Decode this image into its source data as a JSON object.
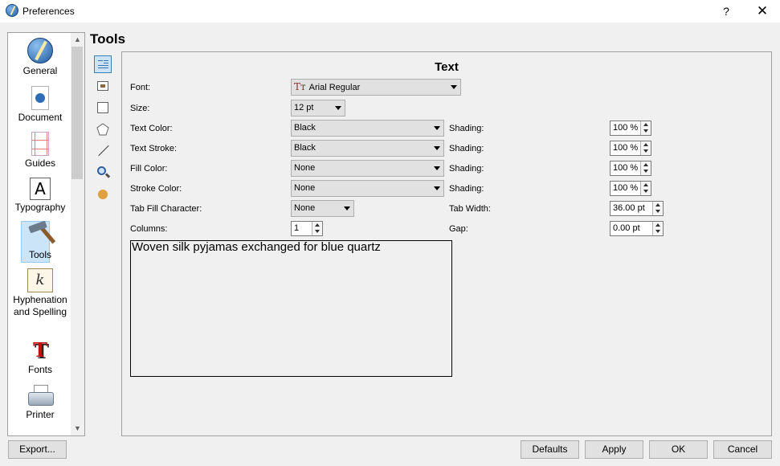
{
  "window": {
    "title": "Preferences",
    "help_label": "?",
    "close_label": "✕"
  },
  "categories": [
    {
      "label": "General",
      "icon": "general-icon"
    },
    {
      "label": "Document",
      "icon": "document-icon"
    },
    {
      "label": "Guides",
      "icon": "guides-icon"
    },
    {
      "label": "Typography",
      "icon": "typography-icon",
      "glyph": "A"
    },
    {
      "label": "Tools",
      "icon": "hammer-icon",
      "selected": true
    },
    {
      "label": "Hyphenation and Spelling",
      "icon": "hyphenation-icon",
      "glyph": "k"
    },
    {
      "label": "Fonts",
      "icon": "fonts-icon",
      "glyph": "T"
    },
    {
      "label": "Printer",
      "icon": "printer-icon"
    }
  ],
  "scroll": {
    "up": "▲",
    "down": "▼"
  },
  "section_title": "Tools",
  "tool_buttons": [
    "text-frame-icon",
    "image-frame-icon",
    "shape-icon",
    "polygon-icon",
    "line-icon",
    "zoom-icon",
    "miscellaneous-icon"
  ],
  "panel": {
    "heading": "Text",
    "font": {
      "label": "Font:",
      "value": "Arial Regular",
      "glyph": "Tт"
    },
    "size": {
      "label": "Size:",
      "value": "12 pt"
    },
    "text_color": {
      "label": "Text Color:",
      "value": "Black",
      "shading_label": "Shading:",
      "shading": "100 %"
    },
    "text_stroke": {
      "label": "Text Stroke:",
      "value": "Black",
      "shading_label": "Shading:",
      "shading": "100 %"
    },
    "fill_color": {
      "label": "Fill Color:",
      "value": "None",
      "shading_label": "Shading:",
      "shading": "100 %"
    },
    "stroke_color": {
      "label": "Stroke Color:",
      "value": "None",
      "shading_label": "Shading:",
      "shading": "100 %"
    },
    "tab_fill": {
      "label": "Tab Fill Character:",
      "value": "None",
      "tab_width_label": "Tab Width:",
      "tab_width": "36.00 pt"
    },
    "columns": {
      "label": "Columns:",
      "value": "1",
      "gap_label": "Gap:",
      "gap": "0.00 pt"
    },
    "preview_text": "Woven silk pyjamas exchanged for blue quartz"
  },
  "footer": {
    "export": "Export...",
    "defaults": "Defaults",
    "apply": "Apply",
    "ok": "OK",
    "cancel": "Cancel"
  }
}
